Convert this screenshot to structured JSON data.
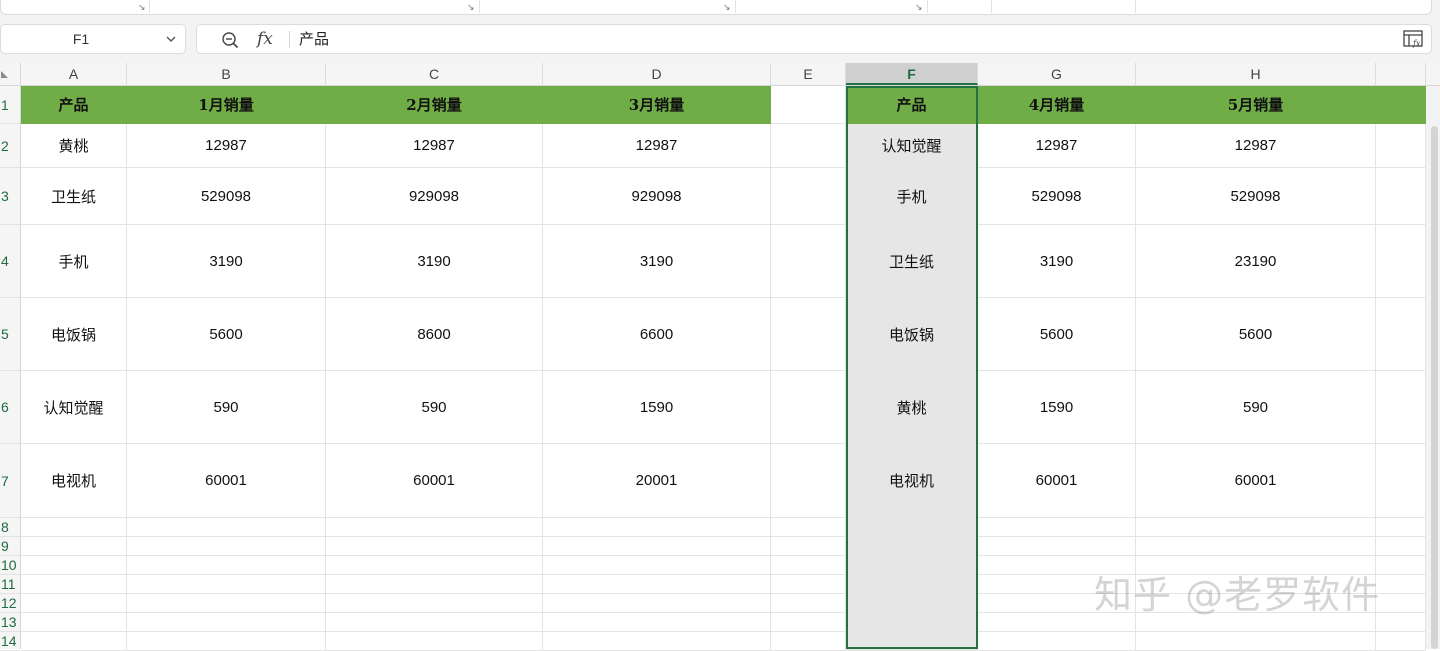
{
  "formula_bar": {
    "cell_reference": "F1",
    "formula_value": "产品"
  },
  "columns": [
    "A",
    "B",
    "C",
    "D",
    "E",
    "F",
    "G",
    "H"
  ],
  "selected_column": "F",
  "rows": [
    "1",
    "2",
    "3",
    "4",
    "5",
    "6",
    "7",
    "8",
    "9",
    "10",
    "11",
    "12",
    "13",
    "14"
  ],
  "table1": {
    "headers": [
      "产品",
      "1月销量",
      "2月销量",
      "3月销量"
    ],
    "rows": [
      [
        "黄桃",
        "12987",
        "12987",
        "12987"
      ],
      [
        "卫生纸",
        "529098",
        "929098",
        "929098"
      ],
      [
        "手机",
        "3190",
        "3190",
        "3190"
      ],
      [
        "电饭锅",
        "5600",
        "8600",
        "6600"
      ],
      [
        "认知觉醒",
        "590",
        "590",
        "1590"
      ],
      [
        "电视机",
        "60001",
        "60001",
        "20001"
      ]
    ]
  },
  "table2": {
    "headers": [
      "产品",
      "4月销量",
      "5月销量"
    ],
    "rows": [
      [
        "认知觉醒",
        "12987",
        "12987"
      ],
      [
        "手机",
        "529098",
        "529098"
      ],
      [
        "卫生纸",
        "3190",
        "23190"
      ],
      [
        "电饭锅",
        "5600",
        "5600"
      ],
      [
        "黄桃",
        "1590",
        "590"
      ],
      [
        "电视机",
        "60001",
        "60001"
      ]
    ]
  },
  "watermark": "知乎 @老罗软件",
  "colors": {
    "header_fill": "#70ad47",
    "selection_border": "#217346",
    "selected_column_fill": "#e6e6e6"
  },
  "icons": {
    "zoom": "zoom-icon",
    "function": "fx-icon",
    "formula_panel": "fx-panel-icon",
    "name_box_dropdown": "chevron-down-icon"
  }
}
